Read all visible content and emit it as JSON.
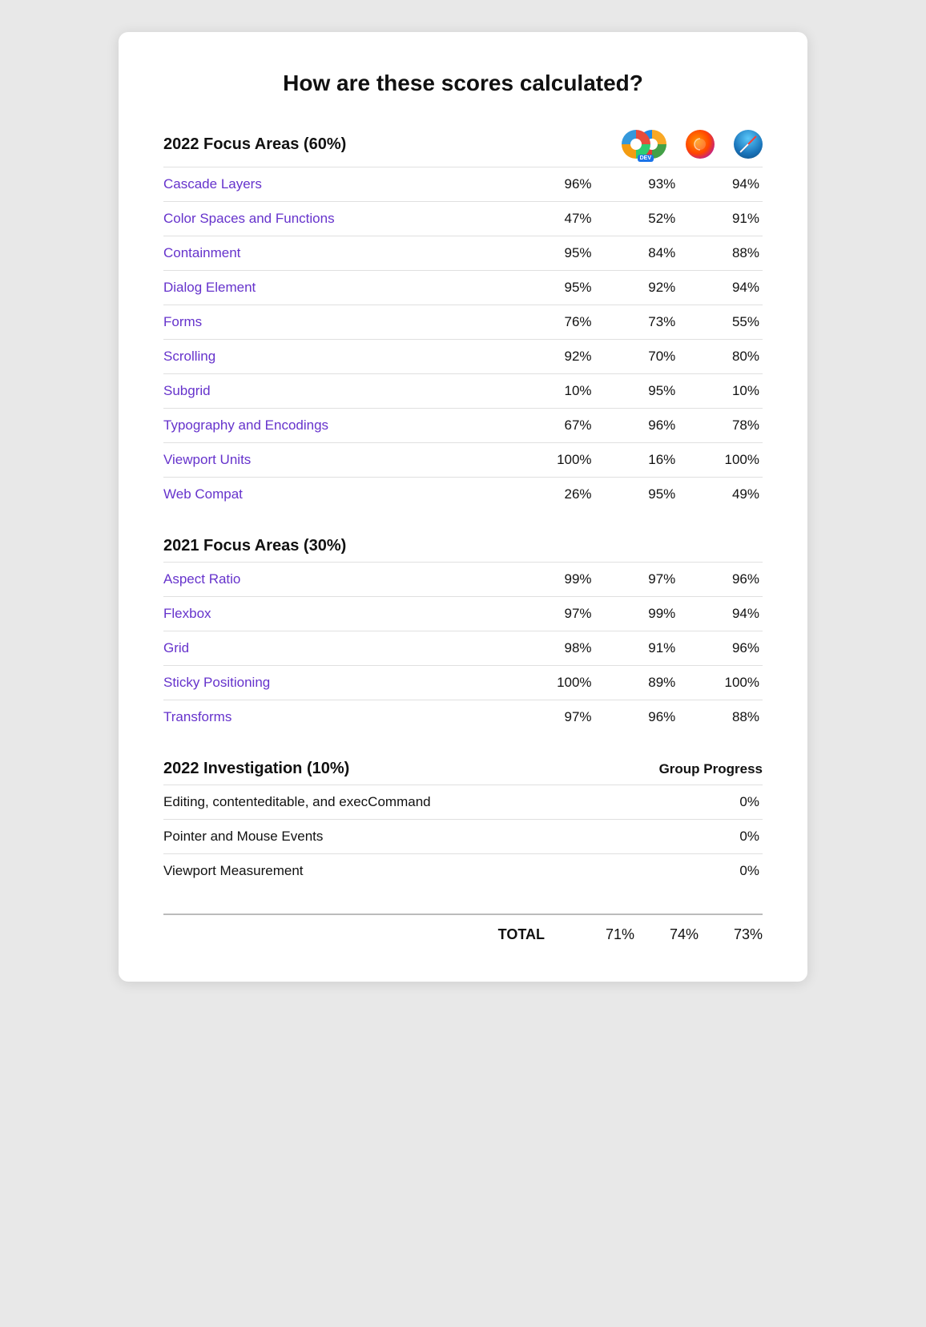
{
  "page": {
    "title": "How are these scores calculated?"
  },
  "section2022": {
    "label": "2022 Focus Areas (60%)",
    "rows": [
      {
        "name": "Cascade Layers",
        "col1": "96%",
        "col2": "93%",
        "col3": "94%"
      },
      {
        "name": "Color Spaces and Functions",
        "col1": "47%",
        "col2": "52%",
        "col3": "91%"
      },
      {
        "name": "Containment",
        "col1": "95%",
        "col2": "84%",
        "col3": "88%"
      },
      {
        "name": "Dialog Element",
        "col1": "95%",
        "col2": "92%",
        "col3": "94%"
      },
      {
        "name": "Forms",
        "col1": "76%",
        "col2": "73%",
        "col3": "55%"
      },
      {
        "name": "Scrolling",
        "col1": "92%",
        "col2": "70%",
        "col3": "80%"
      },
      {
        "name": "Subgrid",
        "col1": "10%",
        "col2": "95%",
        "col3": "10%"
      },
      {
        "name": "Typography and Encodings",
        "col1": "67%",
        "col2": "96%",
        "col3": "78%"
      },
      {
        "name": "Viewport Units",
        "col1": "100%",
        "col2": "16%",
        "col3": "100%"
      },
      {
        "name": "Web Compat",
        "col1": "26%",
        "col2": "95%",
        "col3": "49%"
      }
    ]
  },
  "section2021": {
    "label": "2021 Focus Areas (30%)",
    "rows": [
      {
        "name": "Aspect Ratio",
        "col1": "99%",
        "col2": "97%",
        "col3": "96%"
      },
      {
        "name": "Flexbox",
        "col1": "97%",
        "col2": "99%",
        "col3": "94%"
      },
      {
        "name": "Grid",
        "col1": "98%",
        "col2": "91%",
        "col3": "96%"
      },
      {
        "name": "Sticky Positioning",
        "col1": "100%",
        "col2": "89%",
        "col3": "100%"
      },
      {
        "name": "Transforms",
        "col1": "97%",
        "col2": "96%",
        "col3": "88%"
      }
    ]
  },
  "sectionInvestigation": {
    "label": "2022 Investigation (10%)",
    "group_progress_label": "Group Progress",
    "rows": [
      {
        "name": "Editing, contenteditable, and execCommand",
        "score": "0%"
      },
      {
        "name": "Pointer and Mouse Events",
        "score": "0%"
      },
      {
        "name": "Viewport Measurement",
        "score": "0%"
      }
    ]
  },
  "total": {
    "label": "TOTAL",
    "col1": "71%",
    "col2": "74%",
    "col3": "73%"
  }
}
